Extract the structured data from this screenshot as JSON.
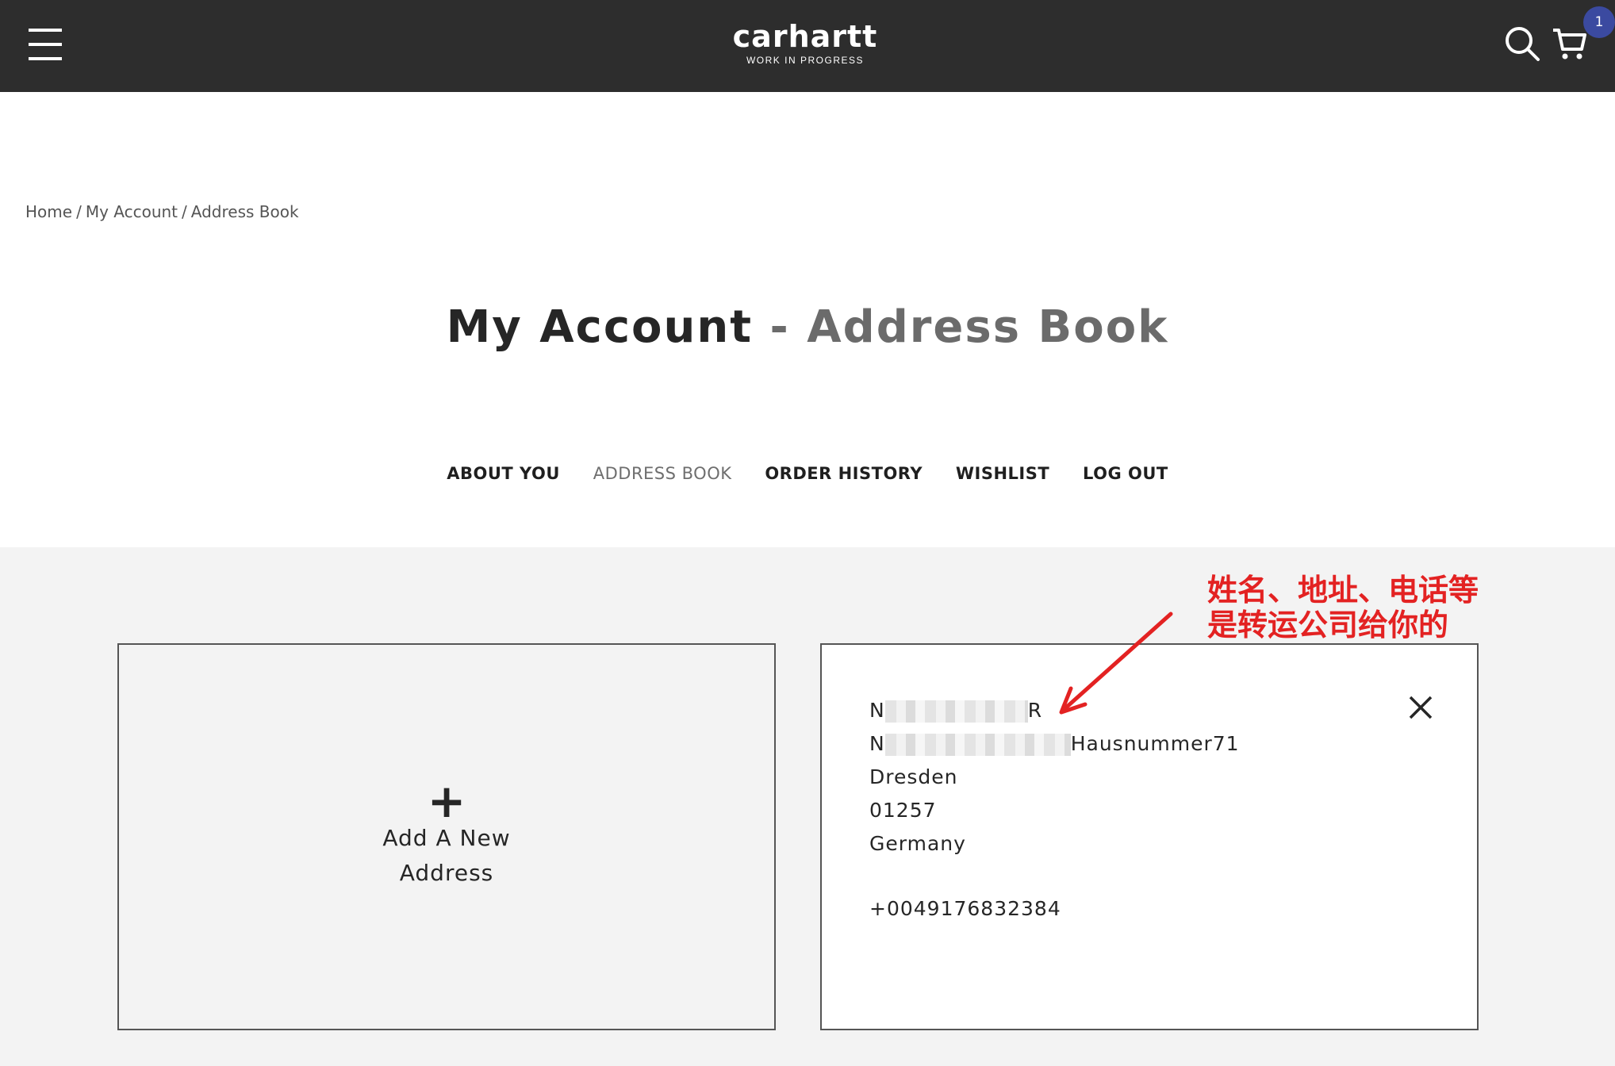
{
  "header": {
    "logo_text": "carhartt",
    "logo_subtitle": "WORK IN PROGRESS",
    "cart_count": "1"
  },
  "breadcrumb": {
    "items": [
      "Home",
      "My Account",
      "Address Book"
    ],
    "separator": "/"
  },
  "page_title": {
    "main": "My Account",
    "separator": "-",
    "sub": "Address Book"
  },
  "account_nav": {
    "items": [
      {
        "label": "ABOUT YOU",
        "active": false
      },
      {
        "label": "ADDRESS BOOK",
        "active": true
      },
      {
        "label": "ORDER HISTORY",
        "active": false
      },
      {
        "label": "WISHLIST",
        "active": false
      },
      {
        "label": "LOG OUT",
        "active": false
      }
    ]
  },
  "new_address_card": {
    "icon": "plus-icon",
    "label_line1": "Add A New",
    "label_line2": "Address"
  },
  "address_card": {
    "name_prefix": "N",
    "name_suffix": "R",
    "street_prefix": "N",
    "street_suffix": "Hausnummer71",
    "city": "Dresden",
    "postcode": "01257",
    "country": "Germany",
    "phone": "+0049176832384"
  },
  "annotation": {
    "line1": "姓名、地址、电话等",
    "line2": "是转运公司给你的",
    "color": "#e32222"
  },
  "colors": {
    "topbar": "#2d2d2d",
    "badge": "#3b4aa0",
    "content_bg": "#f3f3f3"
  }
}
